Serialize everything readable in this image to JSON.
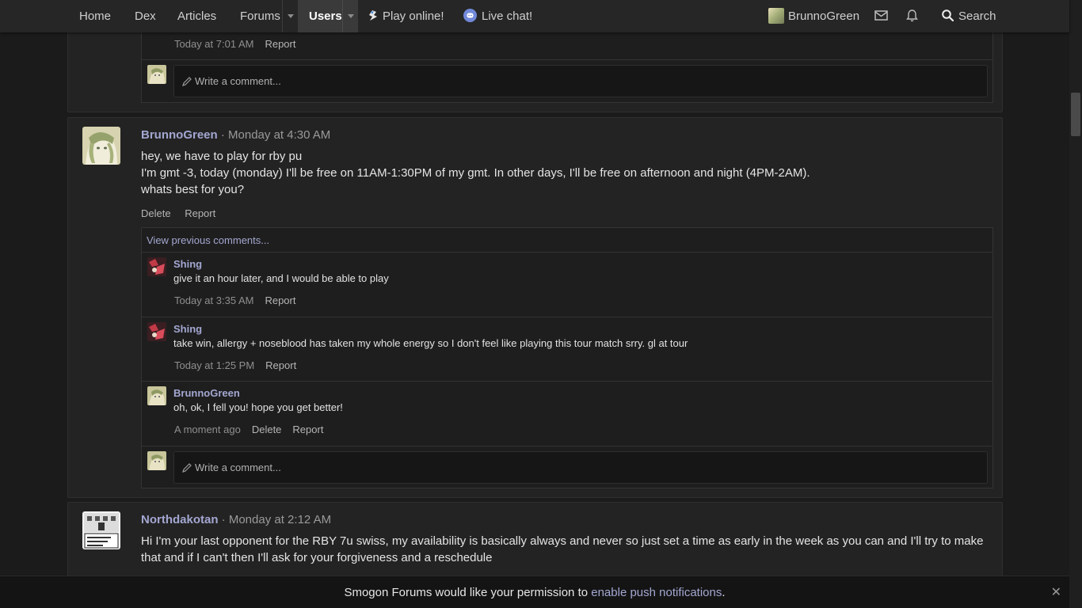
{
  "nav": {
    "home": "Home",
    "dex": "Dex",
    "articles": "Articles",
    "forums": "Forums",
    "users": "Users",
    "play_online": "Play online!",
    "live_chat": "Live chat!",
    "username": "BrunnoGreen",
    "search": "Search"
  },
  "top_fragment": {
    "time": "Today at 7:01 AM",
    "report": "Report",
    "write_placeholder": "Write a comment..."
  },
  "post1": {
    "username": "BrunnoGreen",
    "separator": "·",
    "timestamp": "Monday at 4:30 AM",
    "lines": [
      "hey, we have to play for rby pu",
      "I'm gmt -3, today (monday) I'll be free on 11AM-1:30PM of my gmt. In other days, I'll be free on afternoon and night (4PM-2AM).",
      "whats best for you?"
    ],
    "delete": "Delete",
    "report": "Report",
    "view_previous": "View previous comments...",
    "comments": [
      {
        "user": "Shing",
        "text": "give it an hour later, and I would be able to play",
        "time": "Today at 3:35 AM",
        "delete": "",
        "report": "Report"
      },
      {
        "user": "Shing",
        "text": "take win, allergy + noseblood has taken my whole energy so I don't feel like playing this tour match srry. gl at tour",
        "time": "Today at 1:25 PM",
        "delete": "",
        "report": "Report"
      },
      {
        "user": "BrunnoGreen",
        "text": "oh, ok, I fell you! hope you get better!",
        "time": "A moment ago",
        "delete": "Delete",
        "report": "Report"
      }
    ],
    "write_placeholder": "Write a comment..."
  },
  "post2": {
    "username": "Northdakotan",
    "separator": "·",
    "timestamp": "Monday at 2:12 AM",
    "lines": [
      "Hi I'm your last opponent for the RBY 7u swiss, my availability is basically always and never so just set a time as early in the week as you can and I'll try to make",
      "that and if I can't then I'll ask for your forgiveness and a reschedule"
    ]
  },
  "pushbar": {
    "text_before": "Smogon Forums would like your permission to ",
    "link": "enable push notifications",
    "text_after": ".",
    "close": "✕"
  },
  "colors": {
    "link": "#a3a7d1",
    "background": "#1b1b1b",
    "nav": "#262626",
    "panel": "#232323"
  }
}
